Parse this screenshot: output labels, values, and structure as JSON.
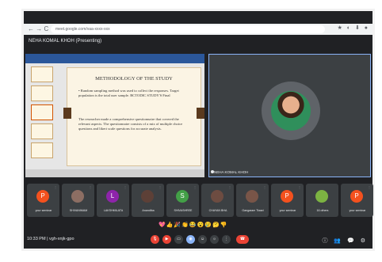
{
  "browser": {
    "nav_icons": "← → C",
    "url": "meet.google.com/vaa-xxxx-xxx",
    "ext_icons": "★ ◐ ⬇ ●"
  },
  "meet": {
    "presenting_title": "NEHA KOMAL KHOH (Presenting)"
  },
  "slide": {
    "heading": "METHODOLOGY OF THE STUDY",
    "bullet1": "• Random sampling method was used to collect the responses. Target population is the total user sample. BCTODIC STUDY'S Final",
    "bullet2": "The researcher made a comprehensive questionnaire that covered the relevant aspects. The questionnaire consists of a mix of multiple choice questions and likert scale questions for accurate analysis."
  },
  "speaker": {
    "name": "NEHA KOMAL KHOH"
  },
  "participants": [
    {
      "initial": "P",
      "name": "your seminar",
      "color": "#f4511e"
    },
    {
      "initial": "",
      "name": "SHIVANIMAM",
      "color": "#8d6e63"
    },
    {
      "initial": "L",
      "name": "LAKSHMILATA",
      "color": "#8e24aa"
    },
    {
      "initial": "",
      "name": "Anandiba",
      "color": "#5d4037"
    },
    {
      "initial": "S",
      "name": "SHIVASHREE",
      "color": "#43a047"
    },
    {
      "initial": "",
      "name": "CHAYAN BHA",
      "color": "#6d4c41"
    },
    {
      "initial": "",
      "name": "Gangaram Tiwari",
      "color": "#795548"
    },
    {
      "initial": "P",
      "name": "your seminar",
      "color": "#f4511e"
    },
    {
      "initial": "",
      "name": "16 others",
      "color": "#7cb342"
    },
    {
      "initial": "P",
      "name": "your seminar",
      "color": "#f4511e"
    }
  ],
  "reactions": "💖👍🎉👏😂😮😢🤔👎",
  "bottom": {
    "time": "10:33 PM | vgh-xnjk-gpo",
    "right_icons": "ⓘ 👥 💬 ⚙"
  },
  "colors": {
    "meet_bg": "#202124",
    "tile_bg": "#3c4043",
    "end_call": "#ea4335",
    "active_border": "#8ab4f8"
  }
}
